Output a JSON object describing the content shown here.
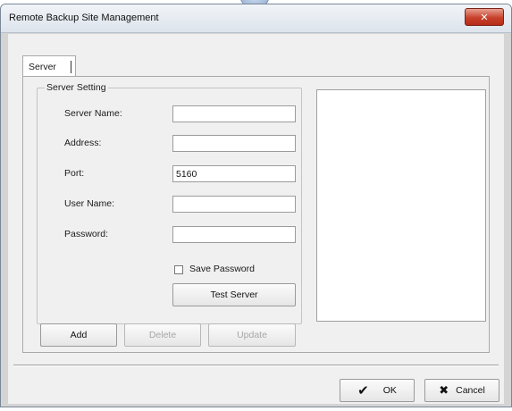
{
  "window": {
    "title": "Remote Backup Site Management",
    "close_glyph": "✕"
  },
  "tabs": [
    {
      "label": "Server"
    }
  ],
  "server_setting": {
    "legend": "Server Setting",
    "fields": [
      {
        "label": "Server Name:",
        "value": ""
      },
      {
        "label": "Address:",
        "value": ""
      },
      {
        "label": "Port:",
        "value": "5160"
      },
      {
        "label": "User Name:",
        "value": ""
      },
      {
        "label": "Password:",
        "value": ""
      }
    ],
    "save_password": {
      "label": "Save Password",
      "checked": false
    },
    "test_server_label": "Test Server"
  },
  "actions": {
    "add": "Add",
    "delete": "Delete",
    "update": "Update"
  },
  "footer": {
    "ok": "OK",
    "cancel": "Cancel",
    "ok_icon": "checkmark-icon",
    "cancel_icon": "x-icon",
    "check_glyph": "✔",
    "x_glyph": "✖"
  }
}
